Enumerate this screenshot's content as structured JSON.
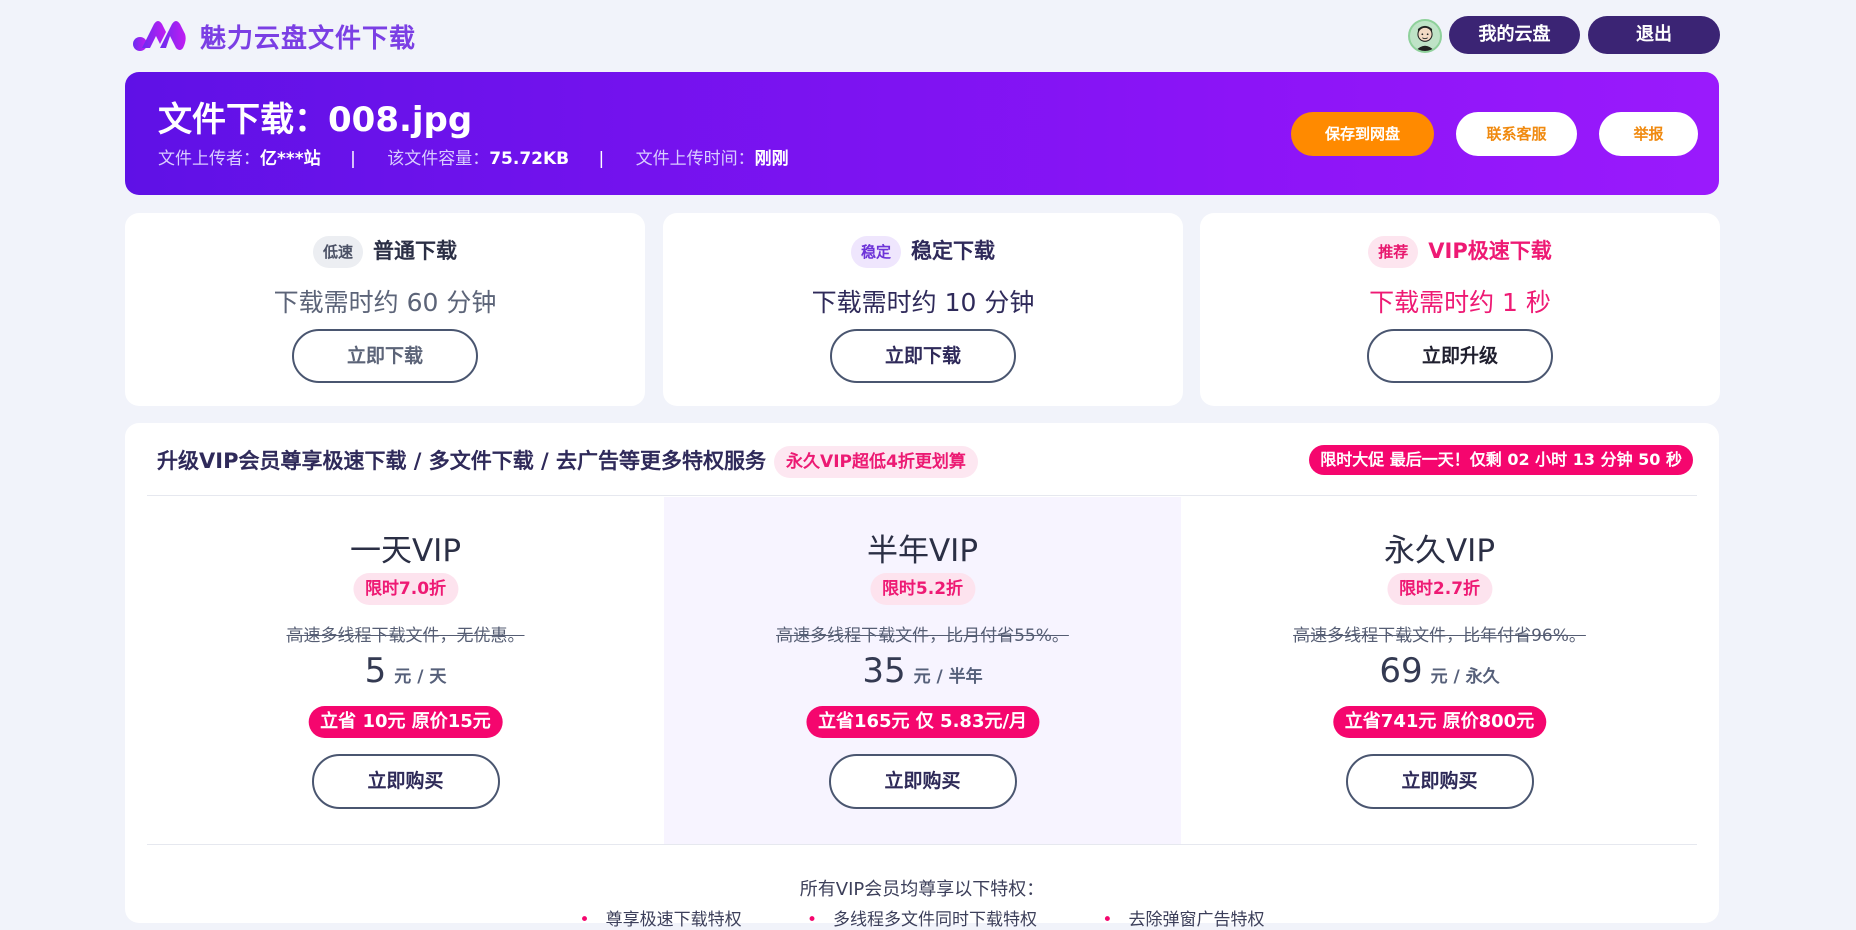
{
  "header": {
    "brand": "魅力云盘文件下载",
    "my_cloud": "我的云盘",
    "logout": "退出"
  },
  "file": {
    "title": "文件下载：008.jpg",
    "uploader_label": "文件上传者：",
    "uploader": "亿***站",
    "sep1": "|",
    "size_label": "该文件容量：",
    "size": "75.72KB",
    "sep2": "|",
    "time_label": "文件上传时间：",
    "time": "刚刚",
    "save_btn": "保存到网盘",
    "service_btn": "联系客服",
    "report_btn": "举报"
  },
  "downloads": [
    {
      "tag": "低速",
      "title": "普通下载",
      "time": "下载需时约 60 分钟",
      "button": "立即下载"
    },
    {
      "tag": "稳定",
      "title": "稳定下载",
      "time": "下载需时约 10 分钟",
      "button": "立即下载"
    },
    {
      "tag": "推荐",
      "title": "VIP极速下载",
      "time": "下载需时约 1 秒",
      "button": "立即升级"
    }
  ],
  "vip": {
    "heading": "升级VIP会员尊享极速下载 / 多文件下载 / 去广告等更多特权服务",
    "heading_tag": "永久VIP超低4折更划算",
    "promo": "限时大促 最后一天！仅剩 02 小时 13 分钟 50 秒",
    "plans": [
      {
        "name": "一天VIP",
        "discount": "限时7.0折",
        "desc": "高速多线程下载文件，无优惠。",
        "price": "5",
        "unit": "元 / 天",
        "save": "立省 10元 原价15元",
        "button": "立即购买"
      },
      {
        "name": "半年VIP",
        "discount": "限时5.2折",
        "desc": "高速多线程下载文件，比月付省55%。",
        "price": "35",
        "unit": "元 / 半年",
        "save": "立省165元 仅 5.83元/月",
        "button": "立即购买"
      },
      {
        "name": "永久VIP",
        "discount": "限时2.7折",
        "desc": "高速多线程下载文件，比年付省96%。",
        "price": "69",
        "unit": "元 / 永久",
        "save": "立省741元 原价800元",
        "button": "立即购买"
      }
    ],
    "perks_title": "所有VIP会员均尊享以下特权：",
    "perks": [
      "尊享极速下载特权",
      "多线程多文件同时下载特权",
      "去除弹窗广告特权"
    ]
  },
  "colors": {
    "brand": "#7b3fe4",
    "hero_start": "#5f11e6",
    "hero_end": "#9a1afc",
    "accent_pink": "#f5066e",
    "orange": "#ff8a00"
  },
  "icons": {
    "logo": "brand-logo-icon",
    "avatar": "user-avatar-icon"
  }
}
